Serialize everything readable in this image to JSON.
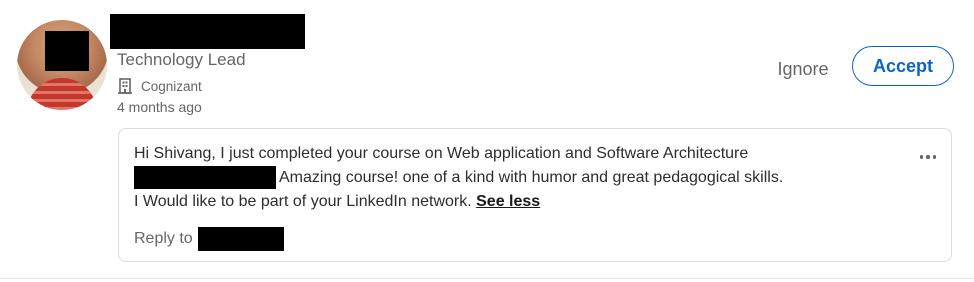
{
  "invitation": {
    "headline": "Technology Lead",
    "company": "Cognizant",
    "company_icon": "building-icon",
    "time_ago": "4 months ago",
    "actions": {
      "ignore_label": "Ignore",
      "accept_label": "Accept",
      "accent_color": "#0a66c2"
    },
    "message": {
      "line1": "Hi Shivang, I just completed your course on Web application and Software Architecture",
      "line2": "Amazing course! one of a kind with humor and great pedagogical skills.",
      "line3": "I Would like to be part of your LinkedIn network.",
      "toggle_label": "See less",
      "reply_label": "Reply to",
      "more_icon": "more-options-icon"
    }
  }
}
